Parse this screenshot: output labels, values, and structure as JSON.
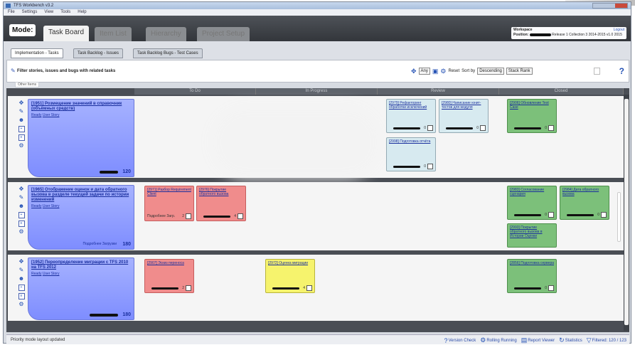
{
  "window": {
    "title": "TFS Workbench v3.2",
    "menu": [
      "File",
      "Settings",
      "View",
      "Tools",
      "Help"
    ]
  },
  "mode": {
    "label": "Mode:",
    "tabs": [
      "Task Board",
      "Item List",
      "Hierarchy",
      "Project Setup"
    ],
    "active": "Task Board"
  },
  "workspace": {
    "label": "Workspace",
    "position_label": "Position:",
    "path_suffix": "Release 1 Collection 3 2014-2015 v1.0 2015",
    "logout": "Logout"
  },
  "subtabs": [
    "Implementation - Tasks",
    "Task Backlog - Issues",
    "Task Backlog Bugs - Test Cases"
  ],
  "toolbar": {
    "filter_text": "Filter stories, issues and bugs with related tasks",
    "view_select": "Any",
    "reset_label": "Reset",
    "sort_label": "Sort by",
    "sort_dir": "Descending",
    "sort_field": "Stack Rank",
    "other_items": "Other Items"
  },
  "columns": [
    "To Do",
    "In Progress",
    "Review",
    "Closed"
  ],
  "stories": [
    {
      "title": "[1951] Розмещение значений в справочник (объёмных средств)",
      "state": "Ready",
      "state_link": "User Story",
      "owner": "",
      "estimate": "120"
    },
    {
      "title": "[1965] Отображение оценок и дата обратного вызова в разделе текущей задачи по истории изменений",
      "state": "Ready",
      "state_link": "User Story",
      "owner": "Подробнее Загрузки",
      "estimate": "180"
    },
    {
      "title": "[1952] Переопределение миграции с TFS 2010 на TFS 2012",
      "state": "Ready",
      "state_link": "User Story",
      "owner": "",
      "estimate": "180"
    }
  ],
  "cards": {
    "row1_review": [
      {
        "title": "[2979] Рефакторинг обработки исключений",
        "hours": "0"
      },
      {
        "title": "[2980] Написание юнит-тестов для модуля",
        "hours": "0"
      },
      {
        "title": "[2998] Подготовка отчёта",
        "hours": "0"
      }
    ],
    "row1_closed": [
      {
        "title": "[2906] Обновление Test Case",
        "hours": "0"
      }
    ],
    "row2_todo": [
      {
        "title": "[2971] Разбор Requirement Client",
        "hours": "2",
        "footer": "Подробнее Загр."
      },
      {
        "title": "[2976] Покрытие обратного вызова",
        "hours": "4"
      }
    ],
    "row2_closed": [
      {
        "title": "[2983] Согласование сценария",
        "hours": "0"
      },
      {
        "title": "[2984] Дата обратного вызова",
        "hours": "0"
      },
      {
        "title": "[2993] Покрытие обратного вызова в Истории Оценки",
        "hours": ""
      }
    ],
    "row3_todo": [
      {
        "title": "[2907] Эскиз переноса",
        "hours": "2"
      }
    ],
    "row3_progress": [
      {
        "title": "[2972] Оценка миграции",
        "hours": "4"
      }
    ],
    "row3_closed": [
      {
        "title": "[2856] Подготовка сервера",
        "hours": "0"
      }
    ]
  },
  "status": {
    "left": "Priority mode layout updated",
    "buttons": [
      "Version Check",
      "Rolling Running",
      "Report Viewer",
      "Statistics",
      "Filtered: 120 / 123"
    ]
  },
  "colors": {
    "story": "#8e9cff",
    "red_card": "#f08c8c",
    "teal_card": "#d7eaf0",
    "green_card": "#7cc07a",
    "yellow_card": "#f6f36d"
  }
}
